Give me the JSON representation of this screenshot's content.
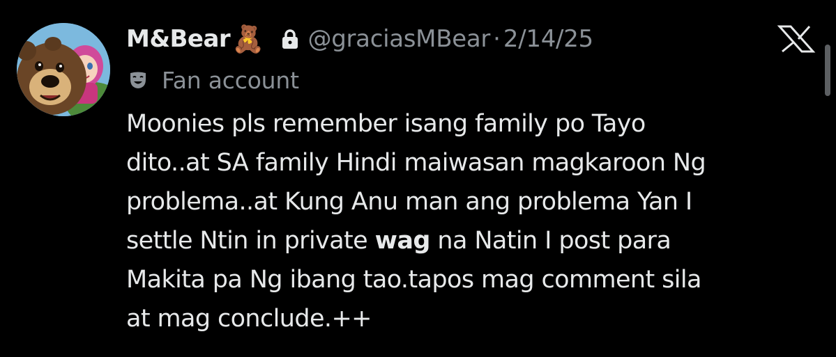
{
  "tweet": {
    "author": {
      "display_name": "M&Bear",
      "emoji": "🧸",
      "handle": "@graciasMBear",
      "protected": true,
      "avatar_icon": "masha-and-bear-avatar"
    },
    "separator": "·",
    "date": "2/14/25",
    "label": {
      "icon": "theater-mask-icon",
      "text": "Fan account"
    },
    "body_lines": [
      {
        "text": "Moonies pls remember isang family po Tayo"
      },
      {
        "text": "dito..at SA family Hindi maiwasan magkaroon Ng"
      },
      {
        "text": "problema..at Kung Anu man ang problema Yan I"
      },
      {
        "before": "settle Ntin in private ",
        "bold": "wag",
        "after": " na Natin I post para"
      },
      {
        "text": "Makita pa Ng ibang tao.tapos mag comment sila"
      },
      {
        "text": "at mag conclude.++"
      }
    ]
  },
  "brand": {
    "icon": "x-logo-icon"
  },
  "colors": {
    "background": "#000000",
    "primary_text": "#e7e9ea",
    "secondary_text": "#8b9197"
  }
}
